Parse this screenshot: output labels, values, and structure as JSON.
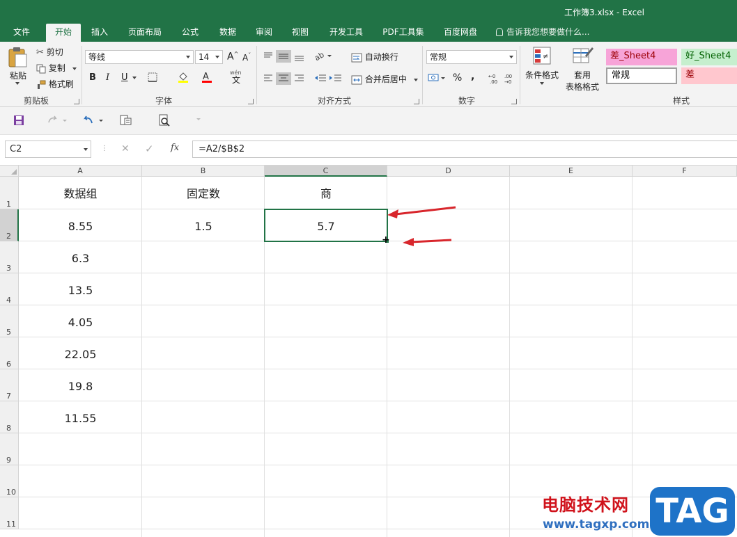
{
  "window": {
    "title": "工作簿3.xlsx - Excel"
  },
  "tabs": [
    {
      "label": "文件"
    },
    {
      "label": "开始"
    },
    {
      "label": "插入"
    },
    {
      "label": "页面布局"
    },
    {
      "label": "公式"
    },
    {
      "label": "数据"
    },
    {
      "label": "审阅"
    },
    {
      "label": "视图"
    },
    {
      "label": "开发工具"
    },
    {
      "label": "PDF工具集"
    },
    {
      "label": "百度网盘"
    }
  ],
  "active_tab": "开始",
  "tell_me": "告诉我您想要做什么...",
  "ribbon": {
    "clipboard": {
      "paste": "粘贴",
      "cut": "剪切",
      "copy": "复制",
      "format_painter": "格式刷",
      "label": "剪贴板"
    },
    "font": {
      "name": "等线",
      "size": "14",
      "grow": "A",
      "shrink": "A",
      "bold": "B",
      "italic": "I",
      "underline": "U",
      "phonetic": "wén",
      "phonetic_char": "文",
      "label": "字体"
    },
    "alignment": {
      "wrap": "自动换行",
      "merge": "合并后居中",
      "label": "对齐方式"
    },
    "number": {
      "format": "常规",
      "percent": "%",
      "comma": ",",
      "label": "数字"
    },
    "styles": {
      "conditional": "条件格式",
      "table_line1": "套用",
      "table_line2": "表格格式",
      "cells": [
        {
          "label": "差_Sheet4",
          "bg": "#f7a4d8",
          "color": "#9c0006"
        },
        {
          "label": "好_Sheet4",
          "bg": "#c6efce",
          "color": "#006100"
        },
        {
          "label": "常规",
          "bg": "#ffffff",
          "color": "#000000"
        },
        {
          "label": "差",
          "bg": "#ffc7ce",
          "color": "#9c0006"
        }
      ],
      "label": "样式"
    }
  },
  "formula_bar": {
    "name_box": "C2",
    "fx": "fx",
    "formula": "=A2/$B$2"
  },
  "columns": [
    "A",
    "B",
    "C",
    "D",
    "E",
    "F"
  ],
  "rows": [
    "1",
    "2",
    "3",
    "4",
    "5",
    "6",
    "7",
    "8",
    "9",
    "10",
    "11"
  ],
  "cells": {
    "A1": "数据组",
    "B1": "固定数",
    "C1": "商",
    "A2": "8.55",
    "B2": "1.5",
    "C2": "5.7",
    "A3": "6.3",
    "A4": "13.5",
    "A5": "4.05",
    "A6": "22.05",
    "A7": "19.8",
    "A8": "11.55"
  },
  "selected_cell": "C2",
  "accent": "#217346",
  "watermark": {
    "text": "电脑技术网",
    "url": "www.tagxp.com",
    "logo": "TAG"
  }
}
